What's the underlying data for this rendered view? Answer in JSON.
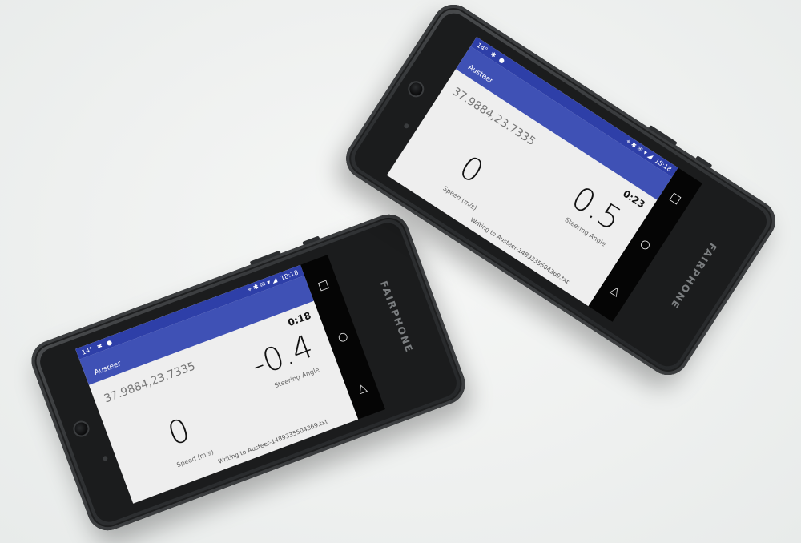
{
  "phones": [
    {
      "id": "left",
      "status": {
        "left": "14°",
        "bluetooth": "✱",
        "notif": "●",
        "right_icons": "⌖ ✱ ✉ ▾ ◢",
        "time": "18:18"
      },
      "app_title": "Austeer",
      "coordinates": "37.9884,23.7335",
      "speed_value": "0",
      "speed_label": "Speed (m/s)",
      "angle_value": "-0.4",
      "angle_label": "Steering Angle",
      "timer": "0:18",
      "writing": "Writing to Austeer-1489335504369.txt",
      "brand": "FAIRPHONE",
      "nav": {
        "back": "◁",
        "home": "○",
        "recent": "□"
      }
    },
    {
      "id": "right",
      "status": {
        "left": "14°",
        "bluetooth": "✱",
        "notif": "●",
        "right_icons": "⌖ ✱ ✉ ▾ ◢",
        "time": "18:18"
      },
      "app_title": "Austeer",
      "coordinates": "37.9884,23.7335",
      "speed_value": "0",
      "speed_label": "Speed (m/s)",
      "angle_value": "0.5",
      "angle_label": "Steering Angle",
      "timer": "0:23",
      "writing": "Writing to Austeer-1489335504369.txt",
      "brand": "FAIRPHONE",
      "nav": {
        "back": "◁",
        "home": "○",
        "recent": "□"
      }
    }
  ]
}
